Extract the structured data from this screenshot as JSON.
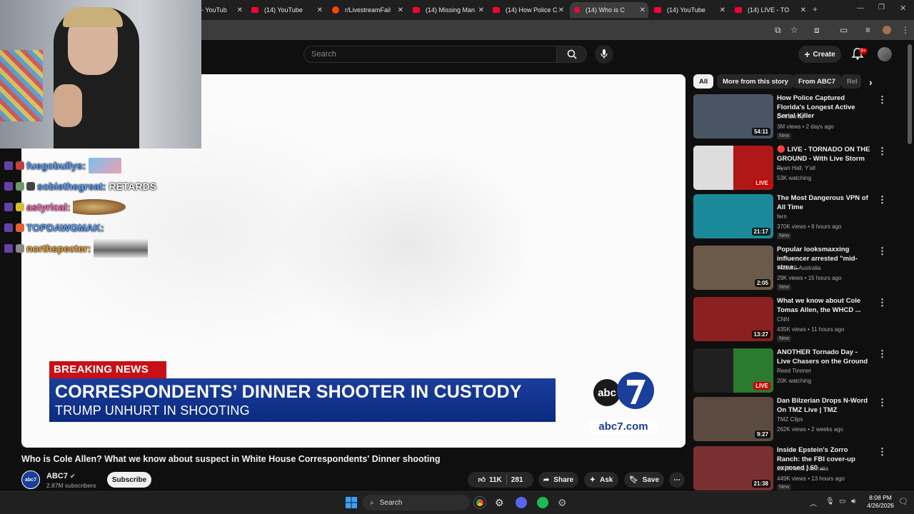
{
  "tabs": [
    {
      "label": "- YouTub",
      "icon": "youtube-icon",
      "active": false
    },
    {
      "label": "(14) YouTube",
      "icon": "youtube-icon",
      "active": false
    },
    {
      "label": "r/LivestreamFail",
      "icon": "reddit-icon",
      "active": false
    },
    {
      "label": "(14) Missing Man",
      "icon": "youtube-icon",
      "active": false
    },
    {
      "label": "(14) How Police C",
      "icon": "youtube-icon",
      "active": false
    },
    {
      "label": "(14) Who is C",
      "icon": "youtube-icon",
      "active": true
    },
    {
      "label": "(14) YouTube",
      "icon": "youtube-icon",
      "active": false
    },
    {
      "label": "(14) LIVE - TO",
      "icon": "youtube-icon",
      "active": false
    }
  ],
  "header": {
    "search_placeholder": "Search",
    "create_label": "Create",
    "notif_count": "9+"
  },
  "video": {
    "breaking_tag": "BREAKING NEWS",
    "headline": "CORRESPONDENTS’ DINNER SHOOTER IN CUSTODY",
    "subline": "TRUMP UNHURT IN SHOOTING",
    "logo_url_text": "abc7.com",
    "title": "Who is Cole Allen? What we know about suspect in White House Correspondents' Dinner shooting",
    "channel": "ABC7",
    "subscribers": "2.87M subscribers",
    "subscribe_label": "Subscribe",
    "likes": "11K",
    "comments": "281",
    "share_label": "Share",
    "ask_label": "Ask",
    "save_label": "Save"
  },
  "chat": [
    {
      "user": "fuegobullys:",
      "color": "#5aa0ff",
      "message": "",
      "emote": true
    },
    {
      "user": "sobiethegreat:",
      "color": "#5aa0ff",
      "message": "RETARDS",
      "emote": false
    },
    {
      "user": "astyrical:",
      "color": "#ff69b4",
      "message": "",
      "emote": true
    },
    {
      "user": "TOPDAWGMAK:",
      "color": "#5aa0ff",
      "message": "",
      "emote": false
    },
    {
      "user": "northspecter:",
      "color": "#f0a030",
      "message": "",
      "emote": true
    }
  ],
  "chips": [
    "All",
    "More from this story",
    "From ABC7",
    "Rel"
  ],
  "recommendations": [
    {
      "title": "How Police Captured Florida's Longest Active Serial Killer",
      "channel": "Dr Insanity",
      "meta": "3M views • 2 days ago",
      "badge": "New",
      "duration": "54:11",
      "live": false,
      "thumb": "#4a5563"
    },
    {
      "title": "🔴 LIVE - TORNADO ON THE GROUND - With Live Storm ...",
      "channel": "Ryan Hall, Y'all",
      "meta": "53K watching",
      "badge": "",
      "duration": "LIVE",
      "live": true,
      "thumb": "#b01818"
    },
    {
      "title": "The Most Dangerous VPN of All Time",
      "channel": "fern",
      "meta": "370K views • 8 hours ago",
      "badge": "New",
      "duration": "21:17",
      "live": false,
      "thumb": "#1a8a9a"
    },
    {
      "title": "Popular looksmaxxing influencer arrested \"mid-strea...",
      "channel": "7NEWS Australia",
      "meta": "29K views • 15 hours ago",
      "badge": "New",
      "duration": "2:05",
      "live": false,
      "thumb": "#6b5a4a"
    },
    {
      "title": "What we know about Cole Tomas Allen, the WHCD ...",
      "channel": "CNN",
      "meta": "435K views • 11 hours ago",
      "badge": "New",
      "duration": "13:27",
      "live": false,
      "thumb": "#8a2020"
    },
    {
      "title": "ANOTHER Tornado Day - Live Chasers on the Ground",
      "channel": "Reed Timmer",
      "meta": "20K watching",
      "badge": "",
      "duration": "LIVE",
      "live": true,
      "thumb": "#2a7a30"
    },
    {
      "title": "Dan Bilzerian Drops N-Word On TMZ Live | TMZ",
      "channel": "TMZ Clips",
      "meta": "262K views • 2 weeks ago",
      "badge": "",
      "duration": "9:27",
      "live": false,
      "thumb": "#5a4a40"
    },
    {
      "title": "Inside Epstein's Zorro Ranch: the FBI cover-up exposed | 60 ...",
      "channel": "60 Minutes Australia",
      "meta": "449K views • 13 hours ago",
      "badge": "New",
      "duration": "21:38",
      "live": false,
      "thumb": "#7a3030"
    }
  ],
  "taskbar": {
    "search_label": "Search",
    "time": "8:08 PM",
    "date": "4/26/2026"
  },
  "colors": {
    "accent": "#ff0033",
    "breaking_red": "#c81016",
    "abc_blue": "#1b3e9b"
  }
}
